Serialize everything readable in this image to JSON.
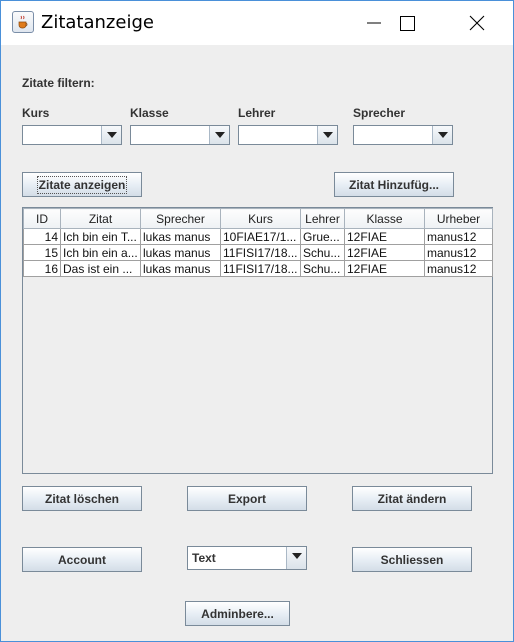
{
  "window": {
    "title": "Zitatanzeige"
  },
  "filter": {
    "heading": "Zitate filtern:",
    "labels": {
      "kurs": "Kurs",
      "klasse": "Klasse",
      "lehrer": "Lehrer",
      "sprecher": "Sprecher"
    },
    "values": {
      "kurs": "",
      "klasse": "",
      "lehrer": "",
      "sprecher": ""
    }
  },
  "buttons": {
    "show": "Zitate anzeigen",
    "add": "Zitat Hinzufüg...",
    "delete": "Zitat löschen",
    "export": "Export",
    "edit": "Zitat ändern",
    "account": "Account",
    "close": "Schliessen",
    "admin": "Adminbere..."
  },
  "format_select": {
    "value": "Text"
  },
  "table": {
    "columns": [
      "ID",
      "Zitat",
      "Sprecher",
      "Kurs",
      "Lehrer",
      "Klasse",
      "Urheber"
    ],
    "rows": [
      [
        "14",
        "Ich bin ein T...",
        "lukas manus",
        "10FIAE17/1...",
        "Grue...",
        "12FIAE",
        "manus12"
      ],
      [
        "15",
        "Ich bin ein a...",
        "lukas manus",
        "11FISI17/18...",
        "Schu...",
        "12FIAE",
        "manus12"
      ],
      [
        "16",
        "Das ist ein ...",
        "lukas manus",
        "11FISI17/18...",
        "Schu...",
        "12FIAE",
        "manus12"
      ]
    ]
  }
}
